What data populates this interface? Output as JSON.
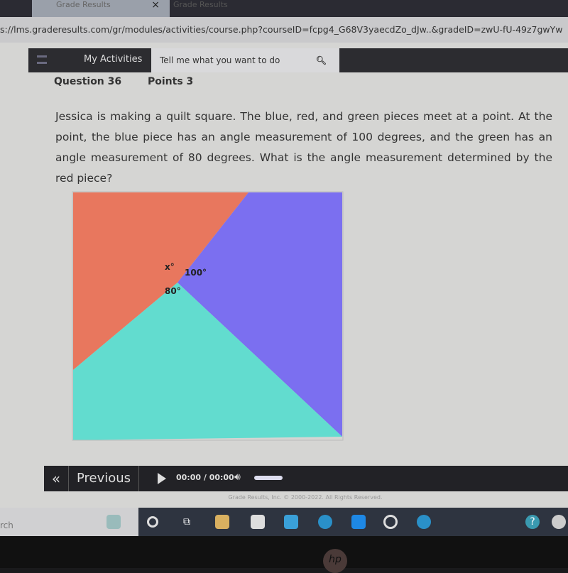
{
  "browser": {
    "tabs": [
      {
        "label": "Grade Results",
        "active": true
      },
      {
        "label": "Grade Results",
        "active": false
      }
    ],
    "url": "s://lms.graderesults.com/gr/modules/activities/course.php?courseID=fcpg4_G68V3yaecdZo_dJw..&gradeID=zwU-fU-49z7gwYw"
  },
  "nav": {
    "my_activities": "My Activities",
    "search_placeholder": "Tell me what you want to do"
  },
  "question": {
    "number": "Question 36",
    "points": "Points 3",
    "text": "Jessica is making a quilt square. The blue, red, and green pieces meet at a point. At the point, the blue piece has an angle measurement of 100 degrees, and the green has an angle measurement of 80 degrees. What is the angle measurement determined by the red piece?"
  },
  "diagram": {
    "labels": {
      "red": "x°",
      "blue": "100°",
      "green": "80°"
    },
    "colors": {
      "red": "#e8775e",
      "blue": "#7b6ff0",
      "green": "#62dccf"
    }
  },
  "player": {
    "previous": "Previous",
    "time": "00:00 / 00:00",
    "volume": 0.8
  },
  "footer": "Grade Results, Inc. © 2000-2022. All Rights Reserved.",
  "taskbar": {
    "search": "rch"
  },
  "laptop": {
    "brand": "hp"
  }
}
